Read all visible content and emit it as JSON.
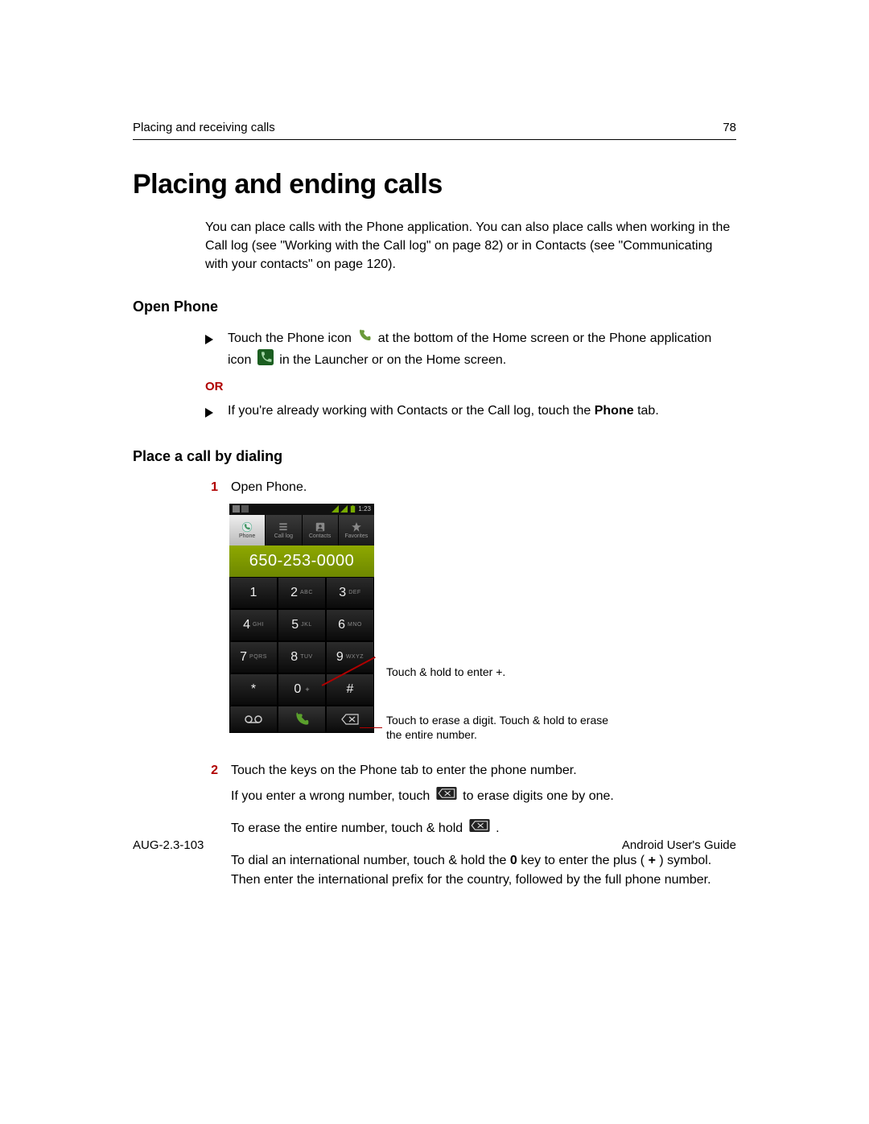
{
  "header": {
    "section": "Placing and receiving calls",
    "page_number": "78"
  },
  "title": "Placing and ending calls",
  "intro": "You can place calls with the Phone application. You can also place calls when working in the Call log (see \"Working with the Call log\" on page 82) or in Contacts (see \"Communicating with your contacts\" on page 120).",
  "sections": {
    "open_phone": {
      "heading": "Open Phone",
      "bullet1_a": "Touch the Phone icon",
      "bullet1_b": "at the bottom of the Home screen or the Phone application icon",
      "bullet1_c": "in the Launcher or on the Home screen.",
      "or": "OR",
      "bullet2_a": "If you're already working with Contacts or the Call log, touch the ",
      "bullet2_b": "Phone",
      "bullet2_c": " tab."
    },
    "place_call": {
      "heading": "Place a call by dialing",
      "step1": "Open Phone.",
      "step2": "Touch the keys on the Phone tab to enter the phone number.",
      "step2_p1a": "If you enter a wrong number, touch",
      "step2_p1b": "to erase digits one by one.",
      "step2_p2a": "To erase the entire number, touch & hold",
      "step2_p2b": ".",
      "step2_p3": "To dial an international number, touch & hold the ",
      "step2_p3_bold1": "0",
      "step2_p3_mid": " key to enter the plus ( ",
      "step2_p3_bold2": "+",
      "step2_p3_end": " ) symbol. Then enter the international prefix for the country, followed by the full phone number."
    }
  },
  "phone": {
    "status_time": "1:23",
    "tabs": [
      "Phone",
      "Call log",
      "Contacts",
      "Favorites"
    ],
    "number": "650-253-0000",
    "keys": [
      {
        "d": "1",
        "l": ""
      },
      {
        "d": "2",
        "l": "ABC"
      },
      {
        "d": "3",
        "l": "DEF"
      },
      {
        "d": "4",
        "l": "GHI"
      },
      {
        "d": "5",
        "l": "JKL"
      },
      {
        "d": "6",
        "l": "MNO"
      },
      {
        "d": "7",
        "l": "PQRS"
      },
      {
        "d": "8",
        "l": "TUV"
      },
      {
        "d": "9",
        "l": "WXYZ"
      },
      {
        "d": "*",
        "l": ""
      },
      {
        "d": "0",
        "l": "",
        "sub": "+"
      },
      {
        "d": "#",
        "l": ""
      }
    ],
    "callout1": "Touch & hold to enter +.",
    "callout2": "Touch to erase a digit. Touch & hold to erase the entire number."
  },
  "footer": {
    "doc_id": "AUG-2.3-103",
    "guide": "Android User's Guide"
  }
}
